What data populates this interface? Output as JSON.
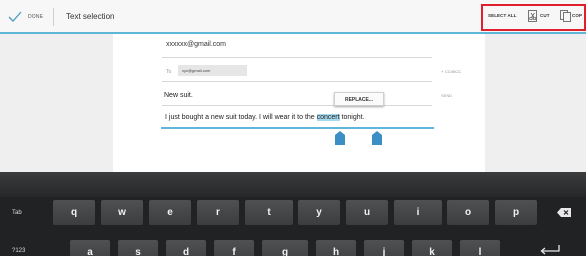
{
  "actionbar": {
    "done_label": "DONE",
    "title": "Text selection",
    "select_all_label": "SELECT ALL",
    "cut_label": "CUT",
    "copy_label": "COP"
  },
  "compose": {
    "from_value": "xxxxxx@gmail.com",
    "to_label": "To",
    "to_chip": "xyz@gmail.com",
    "cc_bcc_label": "+ CC/BCC",
    "subject_value": "New suit.",
    "send_label": "SEND",
    "replace_label": "REPLACE...",
    "body_before": "I just bought a new suit today. I will wear it to the ",
    "body_selected": "concert",
    "body_after": " tonight."
  },
  "keyboard": {
    "tab_label": "Tab",
    "numbers_label": "?123",
    "row1": [
      "q",
      "w",
      "e",
      "r",
      "t",
      "y",
      "u",
      "i",
      "o",
      "p"
    ],
    "row2": [
      "a",
      "s",
      "d",
      "f",
      "g",
      "h",
      "j",
      "k",
      "l"
    ]
  },
  "colors": {
    "accent": "#5fb6d9",
    "selection": "#a7d9ee",
    "highlight_box": "#e0202c",
    "keyboard_bg": "#202224"
  }
}
